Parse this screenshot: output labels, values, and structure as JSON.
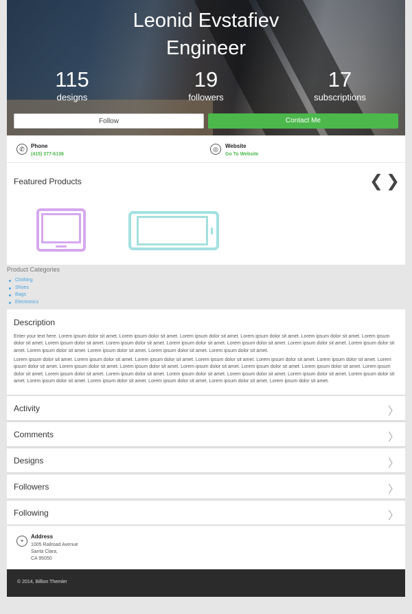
{
  "profile": {
    "name": "Leonid Evstafiev",
    "role": "Engineer"
  },
  "stats": [
    {
      "value": "115",
      "label": "designs"
    },
    {
      "value": "19",
      "label": "followers"
    },
    {
      "value": "17",
      "label": "subscriptions"
    }
  ],
  "actions": {
    "follow_label": "Follow",
    "contact_label": "Contact Me"
  },
  "contact": {
    "phone_title": "Phone",
    "phone_value": "(415) 377-6136",
    "website_title": "Website",
    "website_value": "Go To Website"
  },
  "featured": {
    "title": "Featured Products",
    "prev": "❮",
    "next": "❯"
  },
  "categories": {
    "title": "Product Categories",
    "items": [
      "Clothing",
      "Shoes",
      "Bags",
      "Electronics"
    ]
  },
  "description": {
    "title": "Description",
    "p1": "Enter your text here. Lorem ipsum dolor sit amet. Lorem ipsum dolor sit amet. Lorem ipsum dolor sit amet. Lorem ipsum dolor sit amet. Lorem ipsum dolor sit amet. Lorem ipsum dolor sit amet. Lorem ipsum dolor sit amet. Lorem ipsum dolor sit amet. Lorem ipsum dolor sit amet. Lorem ipsum dolor sit amet. Lorem ipsum dolor sit amet. Lorem ipsum dolor sit amet. Lorem ipsum dolor sit amet. Lorem ipsum dolor sit amet. Lorem ipsum dolor sit amet. Lorem ipsum dolor sit amet.",
    "p2": "Lorem ipsum dolor sit amet. Lorem ipsum dolor sit amet. Lorem ipsum dolor sit amet. Lorem ipsum dolor sit amet. Lorem ipsum dolor sit amet. Lorem ipsum dolor sit amet. Lorem ipsum dolor sit amet. Lorem ipsum dolor sit amet. Lorem ipsum dolor sit amet. Lorem ipsum dolor sit amet. Lorem ipsum dolor sit amet. Lorem ipsum dolor sit amet. Lorem ipsum dolor sit amet. Lorem ipsum dolor sit amet. Lorem ipsum dolor sit amet. Lorem ipsum dolor sit amet. Lorem ipsum dolor sit amet. Lorem ipsum dolor sit amet. Lorem ipsum dolor sit amet. Lorem ipsum dolor sit amet. Lorem ipsum dolor sit amet. Lorem ipsum dolor sit amet. Lorem ipsum dolor sit amet. Lorem ipsum dolor sit amet."
  },
  "sections": [
    "Activity",
    "Comments",
    "Designs",
    "Followers",
    "Following"
  ],
  "address": {
    "title": "Address",
    "line1": "1005 Railroad Avenue",
    "line2": "Santa Clara,",
    "line3": "CA 95050"
  },
  "footer": {
    "text": "© 2014, Billion Themler"
  },
  "colors": {
    "accent": "#4cb84c",
    "link": "#4aa3df",
    "footer_bg": "#2b2b2b",
    "tablet_icon": "#d5a8ee",
    "phone_icon": "#a3e0e0"
  },
  "icons": {
    "phone": "phone-icon",
    "website": "globe-icon",
    "address": "map-pin-icon",
    "chevron": "chevron-right-icon"
  }
}
